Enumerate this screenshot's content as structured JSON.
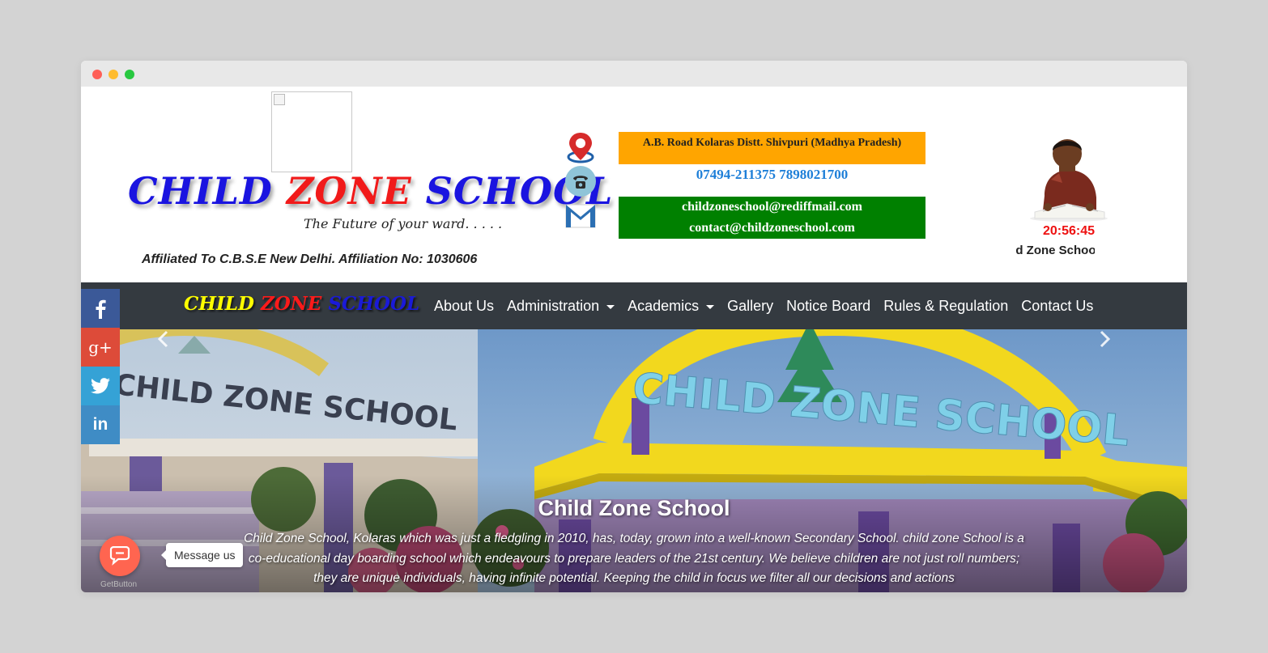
{
  "header": {
    "logo": {
      "word1": "CHILD",
      "word2": "ZONE",
      "word3": "SCHOOL"
    },
    "tagline": "The Future of your ward. . . . .",
    "affiliation": "Affiliated To C.B.S.E New Delhi. Affiliation No: 1030606",
    "address": "A.B. Road Kolaras Distt. Shivpuri (Madhya Pradesh)",
    "phone": "07494-211375 7898021700",
    "emails": [
      "childzoneschool@rediffmail.com",
      "contact@childzoneschool.com"
    ],
    "clock": "20:56:45",
    "marquee": "Child Zone School"
  },
  "nav": {
    "brand": {
      "word1": "CHILD",
      "word2": "ZONE",
      "word3": "SCHOOL"
    },
    "links": [
      {
        "label": "About Us",
        "dropdown": false
      },
      {
        "label": "Administration",
        "dropdown": true
      },
      {
        "label": "Academics",
        "dropdown": true
      },
      {
        "label": "Gallery",
        "dropdown": false
      },
      {
        "label": "Notice Board",
        "dropdown": false
      },
      {
        "label": "Rules & Regulation",
        "dropdown": false
      },
      {
        "label": "Contact Us",
        "dropdown": false
      }
    ]
  },
  "social": {
    "icons": [
      "facebook-icon",
      "google-plus-icon",
      "twitter-icon",
      "linkedin-icon"
    ],
    "gplus_text": "g+",
    "linkedin_text": "in"
  },
  "hero": {
    "sign_left": "CHILD ZONE SCHOOL",
    "sign_right": "CHILD ZONE SCHOOL",
    "caption_title": "Child Zone School",
    "caption_text": "Child Zone School, Kolaras which was just a fledgling in 2010, has, today, grown into a well-known Secondary School. child zone School is a co-educational day boarding school which endeavours to prepare leaders of the 21st century. We believe children are not just roll numbers; they are unique individuals, having infinite potential. Keeping the child in focus we filter all our decisions and actions"
  },
  "getbutton": {
    "label": "Message us",
    "brand": "GetButton"
  },
  "colors": {
    "navbar": "#343a40",
    "address_bg": "#ffa500",
    "email_bg": "#008000",
    "phone_text": "#1e7fd8",
    "clock": "#ee1111"
  }
}
